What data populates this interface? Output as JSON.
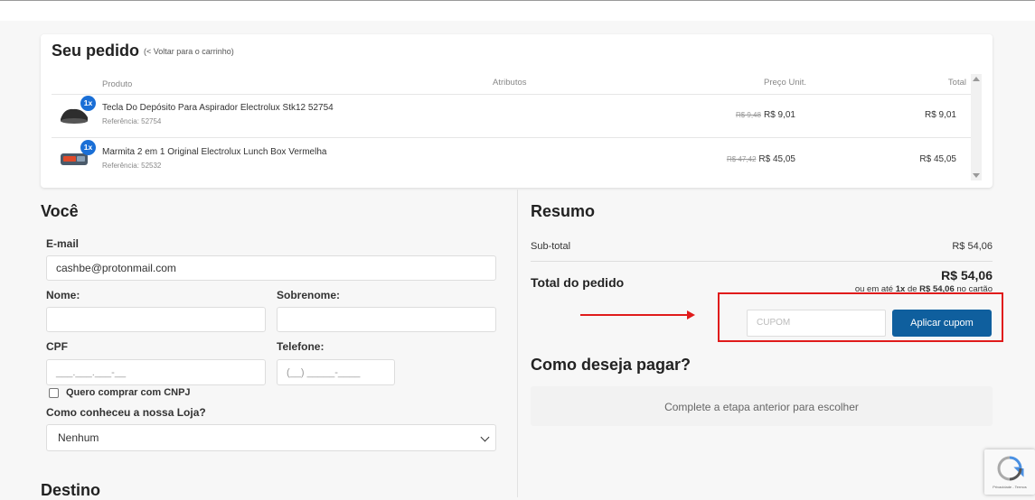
{
  "order": {
    "title": "Seu pedido",
    "back_link": "(< Voltar para o carrinho)",
    "headers": {
      "product": "Produto",
      "attributes": "Atributos",
      "unit_price": "Preço Unit.",
      "total": "Total"
    },
    "items": [
      {
        "qty": "1x",
        "name": "Tecla Do Depósito Para Aspirador Electrolux Stk12 52754",
        "reference": "Referência: 52754",
        "old_price": "R$ 9,48",
        "price": "R$ 9,01",
        "total": "R$ 9,01",
        "image_icon": "vacuum-part-icon"
      },
      {
        "qty": "1x",
        "name": "Marmita 2 em 1 Original Electrolux Lunch Box Vermelha",
        "reference": "Referência: 52532",
        "old_price": "R$ 47,42",
        "price": "R$ 45,05",
        "total": "R$ 45,05",
        "image_icon": "lunch-box-icon"
      }
    ]
  },
  "you": {
    "title": "Você",
    "email_label": "E-mail",
    "email_value": "cashbe@protonmail.com",
    "first_name_label": "Nome:",
    "last_name_label": "Sobrenome:",
    "cpf_label": "CPF",
    "cpf_mask": "___.___.___-__",
    "phone_label": "Telefone:",
    "phone_mask": "(__) _____-____",
    "cnpj_checkbox_label": "Quero comprar com CNPJ",
    "source_label": "Como conheceu a nossa Loja?",
    "source_selected": "Nenhum"
  },
  "destination": {
    "title": "Destino"
  },
  "summary": {
    "title": "Resumo",
    "subtotal_label": "Sub-total",
    "subtotal_value": "R$ 54,06",
    "total_label": "Total do pedido",
    "total_value": "R$ 54,06",
    "installments_prefix": "ou em até",
    "installments_count": "1x",
    "installments_mid": "de",
    "installments_value": "R$ 54,06",
    "installments_suffix": "no cartão",
    "coupon_placeholder": "CUPOM",
    "coupon_button": "Aplicar cupom"
  },
  "payment": {
    "title": "Como deseja pagar?",
    "message": "Complete a etapa anterior para escolher"
  },
  "recaptcha": {
    "text": "Privacidade - Termos"
  },
  "colors": {
    "accent": "#0f5f9e",
    "badge": "#1a6fd6",
    "annotation": "#e01b1b"
  }
}
